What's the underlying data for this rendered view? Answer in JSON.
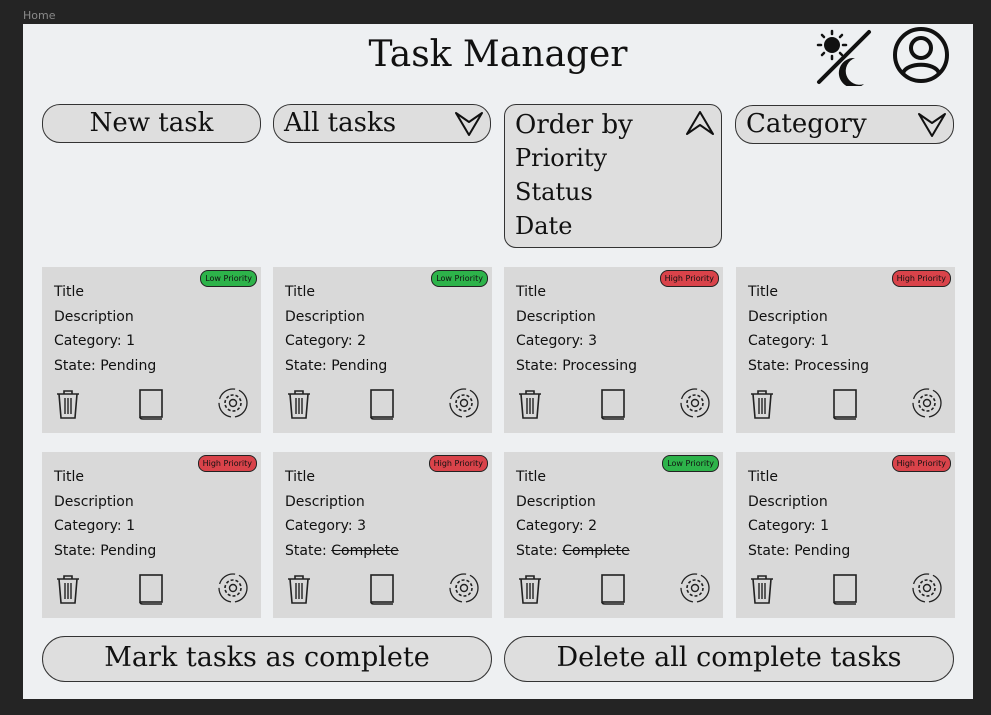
{
  "window": {
    "tab_label": "Home"
  },
  "header": {
    "title": "Task Manager",
    "theme_toggle_icon": "sun-moon-icon",
    "profile_icon": "user-avatar-icon"
  },
  "toolbar": {
    "new_task_label": "New task",
    "filter_label": "All tasks",
    "order": {
      "label": "Order by",
      "options": [
        "Priority",
        "Status",
        "Date"
      ]
    },
    "category_label": "Category"
  },
  "colors": {
    "low_priority": "#2db34a",
    "high_priority": "#d9434a",
    "card_bg": "#d9d9d9",
    "frame_bg": "#eef0f2"
  },
  "cards": [
    {
      "priority": "Low Priority",
      "level": "low",
      "title": "Title",
      "description": "Description",
      "category": "Category: 1",
      "state_prefix": "State: ",
      "state": "Pending",
      "completed": false
    },
    {
      "priority": "Low Priority",
      "level": "low",
      "title": "Title",
      "description": "Description",
      "category": "Category: 2",
      "state_prefix": "State: ",
      "state": "Pending",
      "completed": false
    },
    {
      "priority": "High Priority",
      "level": "high",
      "title": "Title",
      "description": "Description",
      "category": "Category: 3",
      "state_prefix": "State: ",
      "state": "Processing",
      "completed": false
    },
    {
      "priority": "High Priority",
      "level": "high",
      "title": "Title",
      "description": "Description",
      "category": "Category: 1",
      "state_prefix": "State: ",
      "state": "Processing",
      "completed": false
    },
    {
      "priority": "High Priority",
      "level": "high",
      "title": "Title",
      "description": "Description",
      "category": "Category: 1",
      "state_prefix": "State: ",
      "state": "Pending",
      "completed": false
    },
    {
      "priority": "High Priority",
      "level": "high",
      "title": "Title",
      "description": "Description",
      "category": "Category: 3",
      "state_prefix": "State: ",
      "state": "Complete",
      "completed": true
    },
    {
      "priority": "Low Priority",
      "level": "low",
      "title": "Title",
      "description": "Description",
      "category": "Category: 2",
      "state_prefix": "State: ",
      "state": "Complete",
      "completed": true
    },
    {
      "priority": "High Priority",
      "level": "high",
      "title": "Title",
      "description": "Description",
      "category": "Category: 1",
      "state_prefix": "State: ",
      "state": "Pending",
      "completed": false
    }
  ],
  "card_icons": [
    "trash-icon",
    "book-icon",
    "settings-gear-icon"
  ],
  "footer": {
    "mark_complete_label": "Mark tasks as complete",
    "delete_complete_label": "Delete all complete tasks"
  }
}
